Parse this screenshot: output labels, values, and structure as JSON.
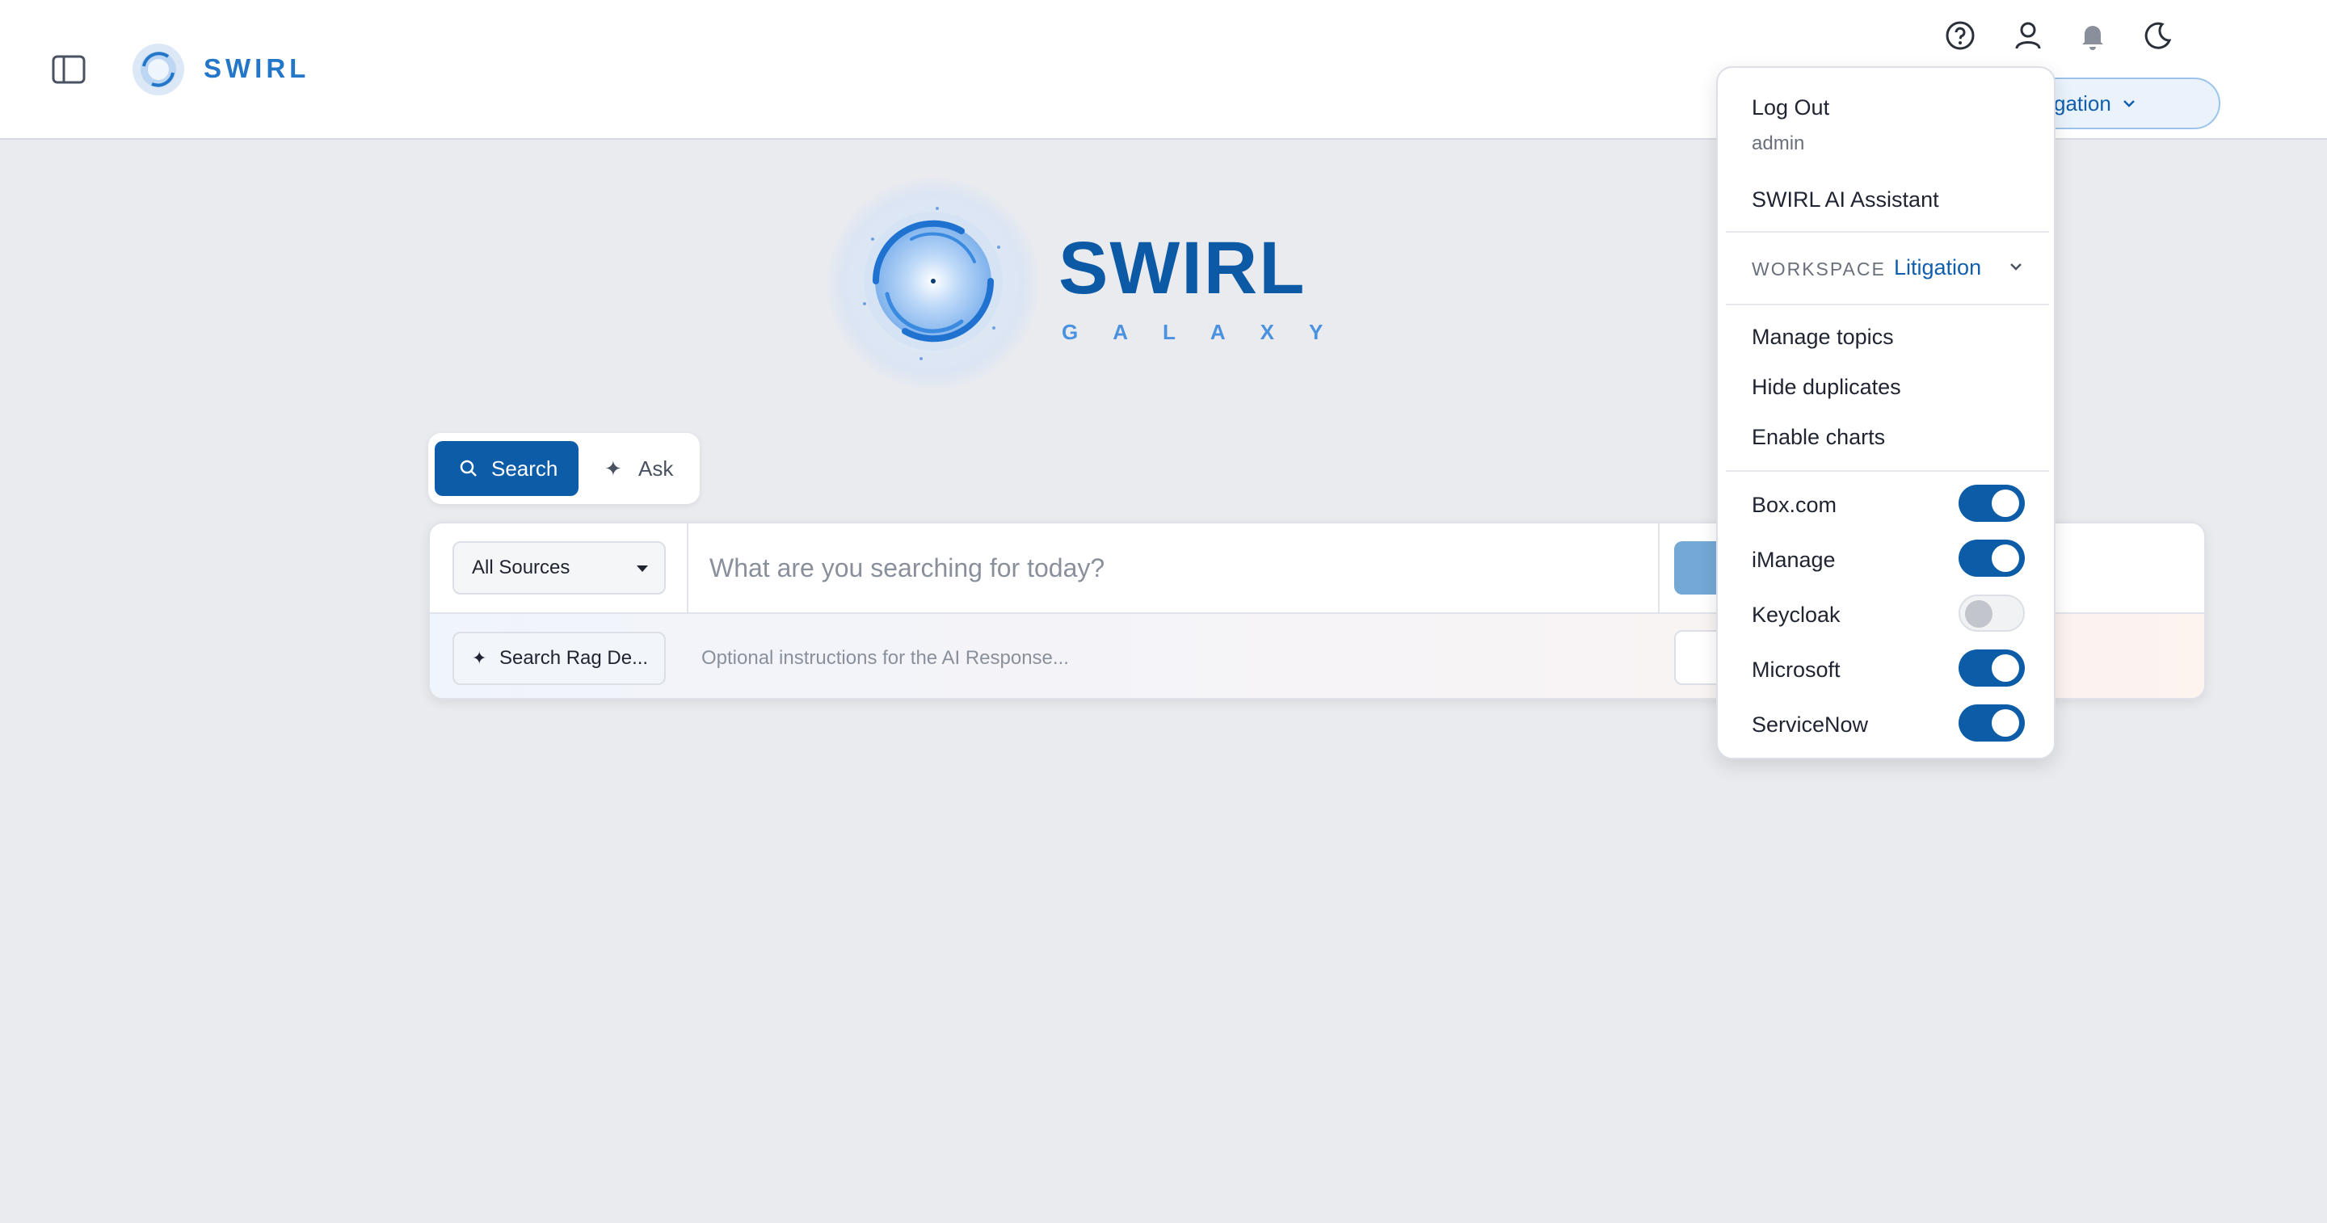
{
  "header": {
    "brand": "SWIRL",
    "workspace_pill": "gation"
  },
  "hero": {
    "title": "SWIRL",
    "subtitle": "GALAXY"
  },
  "modes": {
    "search_label": "Search",
    "ask_label": "Ask"
  },
  "search": {
    "sources_value": "All Sources",
    "placeholder": "What are you searching for today?",
    "rag_label": "Search Rag De...",
    "instructions_placeholder": "Optional instructions for the AI Response..."
  },
  "menu": {
    "logout": "Log Out",
    "username": "admin",
    "assistant": "SWIRL AI Assistant",
    "workspace_label": "WORKSPACE",
    "workspace_value": "Litigation",
    "manage_topics": "Manage topics",
    "hide_duplicates": "Hide duplicates",
    "enable_charts": "Enable charts",
    "sources": [
      {
        "label": "Box.com",
        "enabled": true
      },
      {
        "label": "iManage",
        "enabled": true
      },
      {
        "label": "Keycloak",
        "enabled": false
      },
      {
        "label": "Microsoft",
        "enabled": true
      },
      {
        "label": "ServiceNow",
        "enabled": true
      }
    ]
  },
  "colors": {
    "accent": "#0c5ca8",
    "brand_text": "#2376c8",
    "background": "#e9ebef"
  }
}
